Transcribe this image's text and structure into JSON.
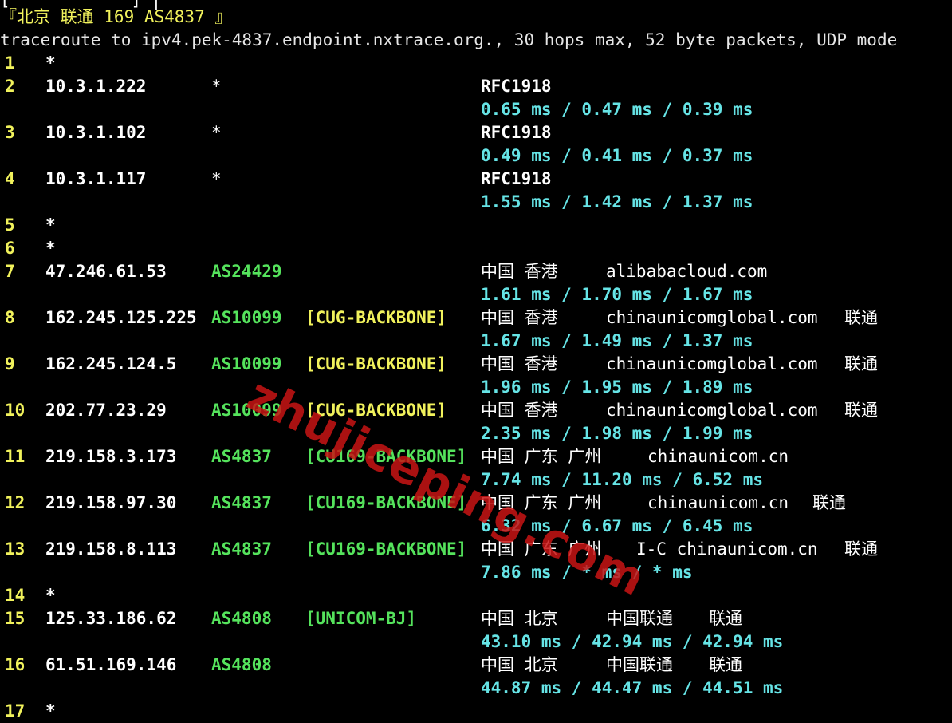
{
  "header": {
    "partial_top": "[            ] |",
    "target_title": "『北京 联通 169 AS4837 』",
    "command": "traceroute to ipv4.pek-4837.endpoint.nxtrace.org., 30 hops max, 52 byte packets, UDP mode"
  },
  "hops": [
    {
      "num": "1",
      "ip": "*",
      "as": "",
      "tag": "",
      "geo": "",
      "host": "",
      "isp": "",
      "rtt": ""
    },
    {
      "num": "2",
      "ip": "10.3.1.222",
      "as": "*",
      "tag": "",
      "geo": "RFC1918",
      "host": "",
      "isp": "",
      "rtt": "0.65 ms / 0.47 ms / 0.39 ms"
    },
    {
      "num": "3",
      "ip": "10.3.1.102",
      "as": "*",
      "tag": "",
      "geo": "RFC1918",
      "host": "",
      "isp": "",
      "rtt": "0.49 ms / 0.41 ms / 0.37 ms"
    },
    {
      "num": "4",
      "ip": "10.3.1.117",
      "as": "*",
      "tag": "",
      "geo": "RFC1918",
      "host": "",
      "isp": "",
      "rtt": "1.55 ms / 1.42 ms / 1.37 ms"
    },
    {
      "num": "5",
      "ip": "*",
      "as": "",
      "tag": "",
      "geo": "",
      "host": "",
      "isp": "",
      "rtt": ""
    },
    {
      "num": "6",
      "ip": "*",
      "as": "",
      "tag": "",
      "geo": "",
      "host": "",
      "isp": "",
      "rtt": ""
    },
    {
      "num": "7",
      "ip": "47.246.61.53",
      "as": "AS24429",
      "tag": "",
      "geo": "中国 香港",
      "host": "alibabacloud.com",
      "isp": "",
      "rtt": "1.61 ms / 1.70 ms / 1.67 ms"
    },
    {
      "num": "8",
      "ip": "162.245.125.225",
      "as": "AS10099",
      "tag": "[CUG-BACKBONE]",
      "geo": "中国 香港",
      "host": "chinaunicomglobal.com",
      "isp": "联通",
      "rtt": "1.67 ms / 1.49 ms / 1.37 ms"
    },
    {
      "num": "9",
      "ip": "162.245.124.5",
      "as": "AS10099",
      "tag": "[CUG-BACKBONE]",
      "geo": "中国 香港",
      "host": "chinaunicomglobal.com",
      "isp": "联通",
      "rtt": "1.96 ms / 1.95 ms / 1.89 ms"
    },
    {
      "num": "10",
      "ip": "202.77.23.29",
      "as": "AS10099",
      "tag": "[CUG-BACKBONE]",
      "geo": "中国 香港",
      "host": "chinaunicomglobal.com",
      "isp": "联通",
      "rtt": "2.35 ms / 1.98 ms / 1.99 ms"
    },
    {
      "num": "11",
      "ip": "219.158.3.173",
      "as": "AS4837",
      "tag": "[CU169-BACKBONE]",
      "geo": "中国 广东 广州",
      "host": "chinaunicom.cn",
      "isp": "",
      "rtt": "7.74 ms / 11.20 ms / 6.52 ms"
    },
    {
      "num": "12",
      "ip": "219.158.97.30",
      "as": "AS4837",
      "tag": "[CU169-BACKBONE]",
      "geo": "中国 广东 广州",
      "host": "chinaunicom.cn",
      "isp": "联通",
      "rtt": "6.32 ms / 6.67 ms / 6.45 ms"
    },
    {
      "num": "13",
      "ip": "219.158.8.113",
      "as": "AS4837",
      "tag": "[CU169-BACKBONE]",
      "geo": "中国 广东 广州",
      "host": "I-C chinaunicom.cn",
      "isp": "联通",
      "rtt": "7.86 ms / * ms / * ms"
    },
    {
      "num": "14",
      "ip": "*",
      "as": "",
      "tag": "",
      "geo": "",
      "host": "",
      "isp": "",
      "rtt": ""
    },
    {
      "num": "15",
      "ip": "125.33.186.62",
      "as": "AS4808",
      "tag": "[UNICOM-BJ]",
      "geo": "中国 北京",
      "host": "中国联通",
      "isp": "联通",
      "rtt": "43.10 ms / 42.94 ms / 42.94 ms"
    },
    {
      "num": "16",
      "ip": "61.51.169.146",
      "as": "AS4808",
      "tag": "",
      "geo": "中国 北京",
      "host": "中国联通",
      "isp": "联通",
      "rtt": "44.87 ms / 44.47 ms / 44.51 ms"
    },
    {
      "num": "17",
      "ip": "*",
      "as": "",
      "tag": "",
      "geo": "",
      "host": "",
      "isp": "",
      "rtt": ""
    }
  ],
  "watermark": "zhujiceping.com",
  "colors": {
    "background": "#000000",
    "hop_number": "#f1f25c",
    "ip": "#ffffff",
    "asn": "#55e35c",
    "cug_tag": "#f1f25c",
    "cu169_tag": "#55e35c",
    "rtt": "#66e4e6",
    "watermark": "#c81414"
  }
}
